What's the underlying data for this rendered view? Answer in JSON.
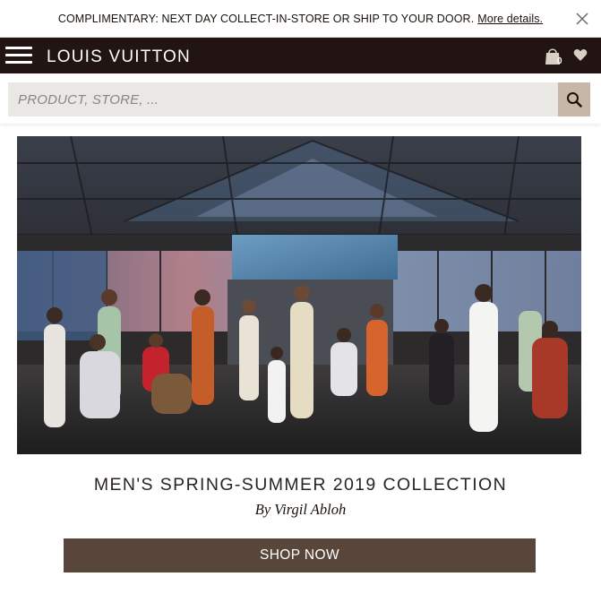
{
  "promo": {
    "text": "COMPLIMENTARY: NEXT DAY COLLECT-IN-STORE OR SHIP TO YOUR DOOR.",
    "link_text": "More details.",
    "close_icon": "close-icon"
  },
  "header": {
    "brand": "LOUIS VUITTON",
    "menu_icon": "hamburger-menu-icon",
    "bag_icon": "shopping-bag-icon",
    "bag_count": "0",
    "wishlist_icon": "heart-icon",
    "background_color": "#221412"
  },
  "search": {
    "placeholder": "PRODUCT, STORE, ...",
    "value": "",
    "button_icon": "search-icon",
    "button_color": "#c8b6a6"
  },
  "hero": {
    "image_description_icon": "campaign-photo"
  },
  "collection": {
    "title": "MEN'S SPRING-SUMMER 2019 COLLECTION",
    "byline": "By Virgil Abloh",
    "cta_label": "SHOP NOW",
    "cta_color": "#59463b"
  }
}
